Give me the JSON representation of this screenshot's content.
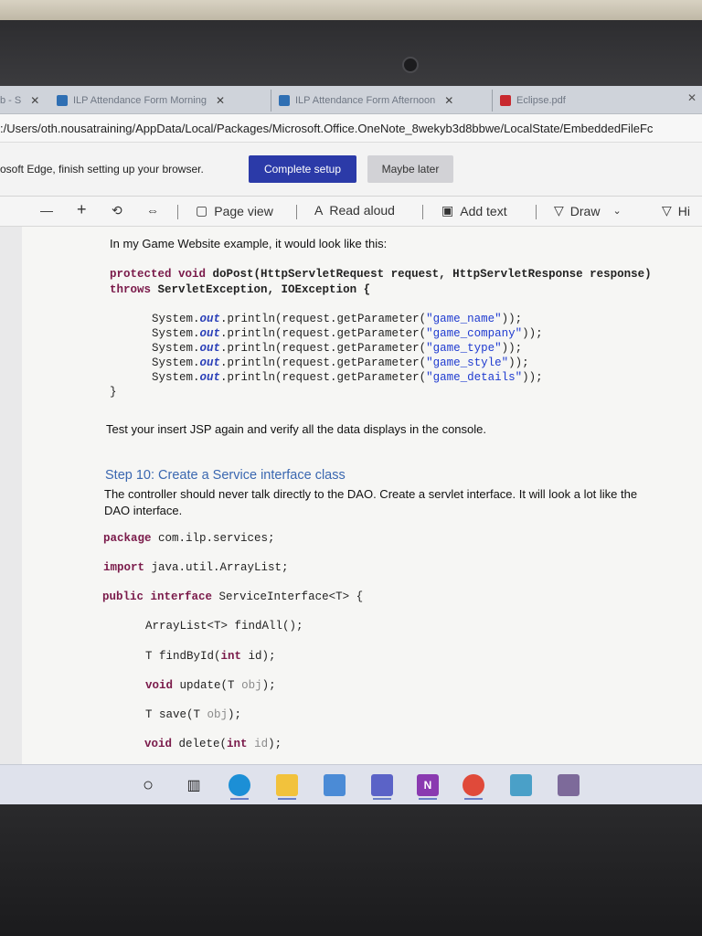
{
  "tabs": [
    {
      "label": "b - S",
      "active": false
    },
    {
      "label": "ILP Attendance Form Morning",
      "active": false
    },
    {
      "label": "ILP Attendance Form Afternoon",
      "active": false
    },
    {
      "label": "Eclipse.pdf",
      "active": true
    }
  ],
  "address": {
    "url": ":/Users/oth.nousatraining/AppData/Local/Packages/Microsoft.Office.OneNote_8wekyb3d8bbwe/LocalState/EmbeddedFileFc"
  },
  "banner": {
    "text": "osoft Edge, finish setting up your browser.",
    "complete_label": "Complete setup",
    "later_label": "Maybe later"
  },
  "pdf_toolbar": {
    "minus": "—",
    "plus": "+",
    "page_view": "Page view",
    "read_aloud": "Read aloud",
    "add_text": "Add text",
    "draw": "Draw",
    "highlight": "Hi"
  },
  "document": {
    "intro": "In my Game Website example, it would look like this:",
    "dopost_sig_1_kw": "protected void",
    "dopost_sig_1_rest": "doPost(HttpServletRequest request, HttpServletResponse response)",
    "dopost_sig_2_kw": "throws",
    "dopost_sig_2_rest": "ServletException, IOException {",
    "println_lines": [
      {
        "prefix": "System.",
        "out": "out",
        "call": ".println(request.getParameter(",
        "arg": "\"game_name\"",
        "end": "));"
      },
      {
        "prefix": "System.",
        "out": "out",
        "call": ".println(request.getParameter(",
        "arg": "\"game_company\"",
        "end": "));"
      },
      {
        "prefix": "System.",
        "out": "out",
        "call": ".println(request.getParameter(",
        "arg": "\"game_type\"",
        "end": "));"
      },
      {
        "prefix": "System.",
        "out": "out",
        "call": ".println(request.getParameter(",
        "arg": "\"game_style\"",
        "end": "));"
      },
      {
        "prefix": "System.",
        "out": "out",
        "call": ".println(request.getParameter(",
        "arg": "\"game_details\"",
        "end": "));"
      }
    ],
    "close_brace": "}",
    "test_text": "Test your insert JSP again and verify all the data displays in the console.",
    "step_heading": "Step 10: Create a Service interface class",
    "step_para_1": "The controller should never talk directly to the DAO. Create a servlet interface. It will look a lot like the",
    "step_para_2": "DAO interface.",
    "pkg_kw": "package",
    "pkg_rest": "com.ilp.services;",
    "imp_kw": "import",
    "imp_rest": "java.util.ArrayList;",
    "iface_kw": "public interface",
    "iface_rest": "ServiceInterface<T> {",
    "m1": "ArrayList<T> findAll();",
    "m2_a": "T findById(",
    "m2_kw": "int",
    "m2_b": "id);",
    "m3_kw": "void",
    "m3_a": "update(T",
    "m3_dim": "obj",
    "m3_b": ");",
    "m4_a": "T save(T",
    "m4_dim": "obj",
    "m4_b": ");",
    "m5_kw": "void",
    "m5_a": "delete(",
    "m5_kw2": "int",
    "m5_dim": "id",
    "m5_b": ");"
  },
  "colors": {
    "accent_button": "#2b3aa8",
    "keyword": "#7a1a4a",
    "string": "#1f3bd0",
    "heading": "#3a67b0"
  },
  "taskbar_icons": [
    "search-circle-icon",
    "task-view-icon",
    "edge-icon",
    "file-explorer-icon",
    "store-icon",
    "teams-icon",
    "onenote-icon",
    "chrome-icon",
    "app-icon",
    "app-icon-2"
  ]
}
